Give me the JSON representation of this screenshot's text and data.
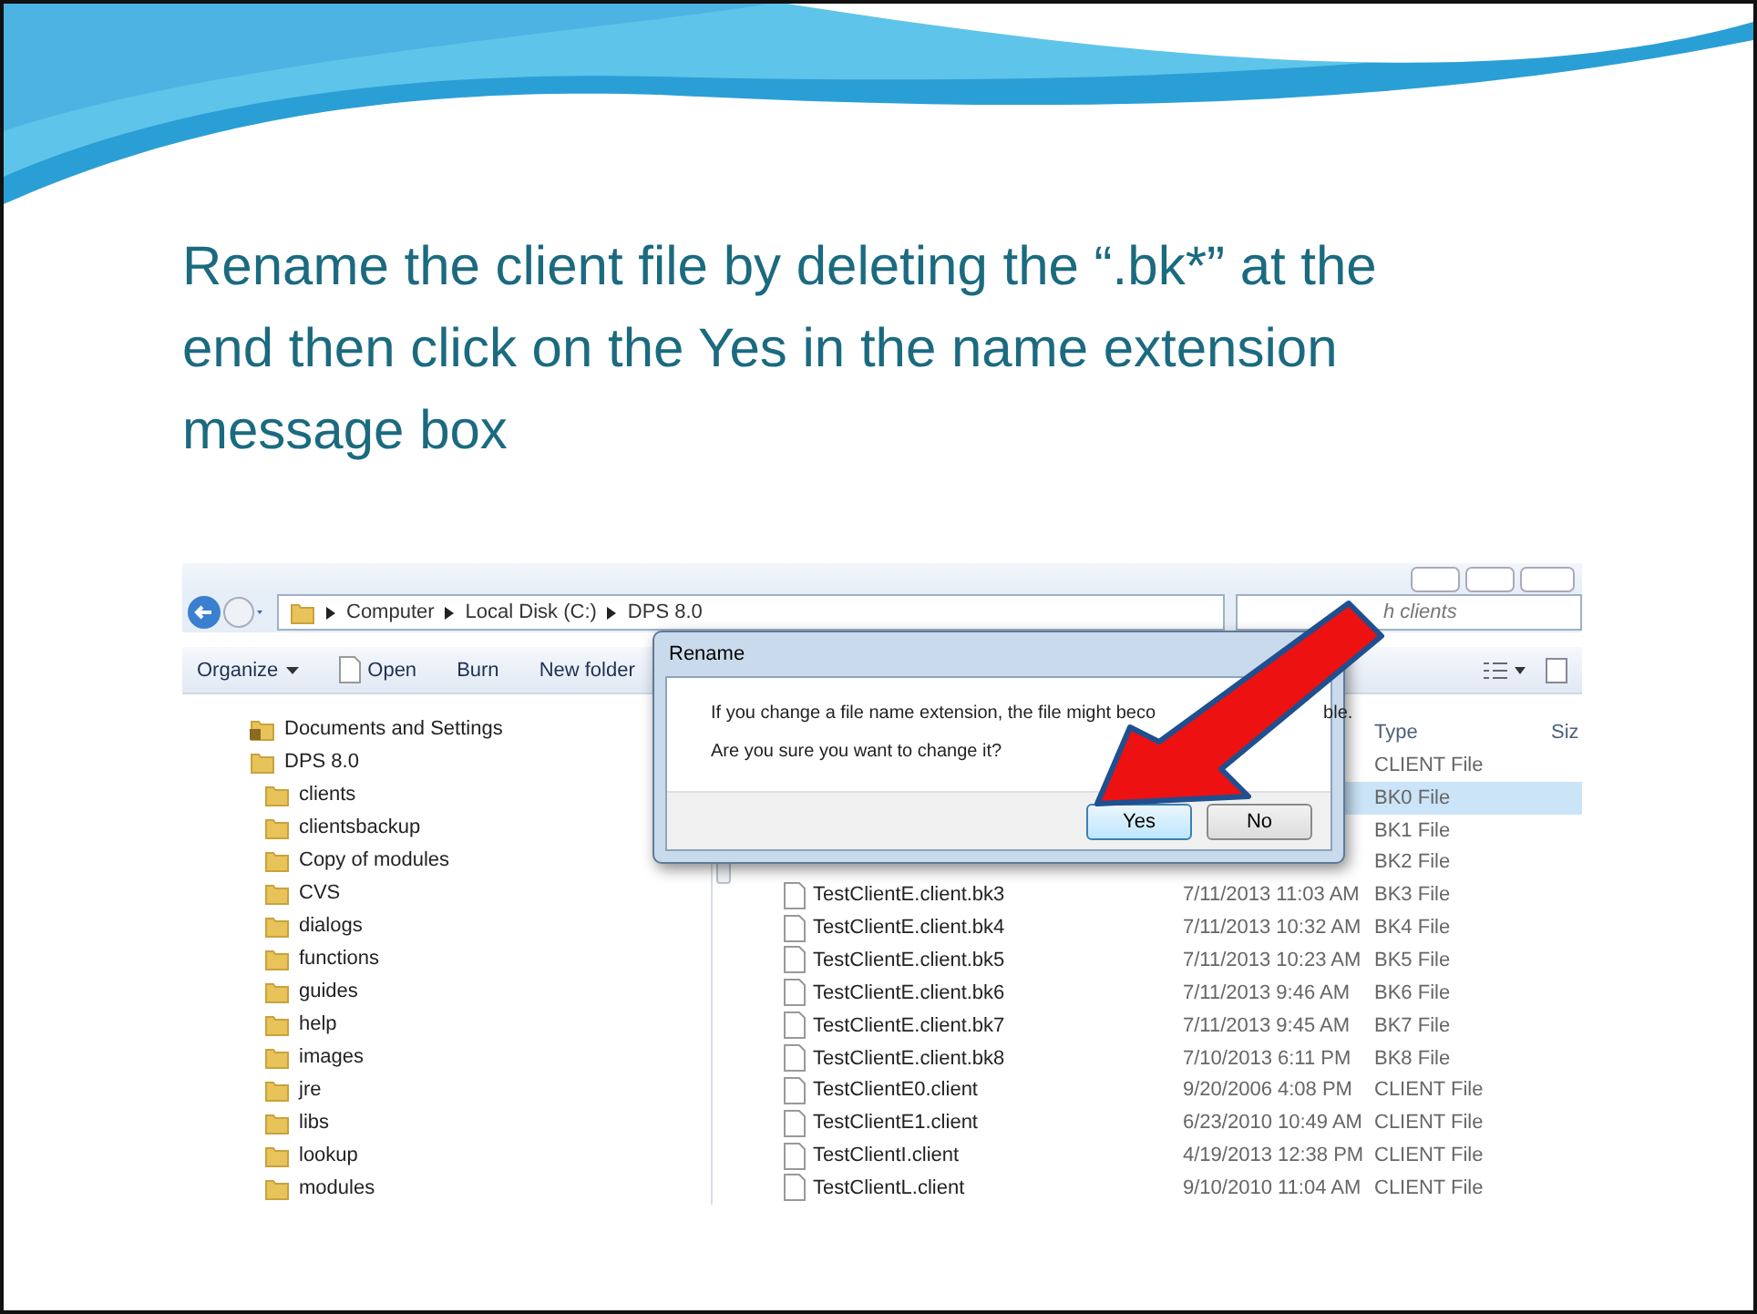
{
  "slide": {
    "title": "Rename the client file by deleting the “.bk*” at the end then click on the Yes in the name extension message box"
  },
  "explorer": {
    "address_path": [
      "Computer",
      "Local Disk (C:)",
      "DPS 8.0"
    ],
    "search_text": "h clients",
    "toolbar": [
      {
        "label": "Organize",
        "kind": "menu"
      },
      {
        "label": "Open",
        "kind": "file"
      },
      {
        "label": "Burn",
        "kind": "plain"
      },
      {
        "label": "New folder",
        "kind": "plain"
      }
    ],
    "tree": [
      {
        "label": "Documents and Settings",
        "locked": true
      },
      {
        "label": "DPS 8.0",
        "locked": false,
        "children": [
          {
            "label": "clients",
            "locked": false
          },
          {
            "label": "clientsbackup",
            "locked": false
          },
          {
            "label": "Copy of modules",
            "locked": false
          },
          {
            "label": "CVS",
            "locked": false
          },
          {
            "label": "dialogs",
            "locked": false
          },
          {
            "label": "functions",
            "locked": false
          },
          {
            "label": "guides",
            "locked": false
          },
          {
            "label": "help",
            "locked": false
          },
          {
            "label": "images",
            "locked": false
          },
          {
            "label": "jre",
            "locked": false
          },
          {
            "label": "libs",
            "locked": false
          },
          {
            "label": "lookup",
            "locked": false
          },
          {
            "label": "modules",
            "locked": false
          }
        ]
      }
    ],
    "columns": [
      "Type",
      "Siz"
    ],
    "files": [
      {
        "type": "CLIENT File",
        "selected": false
      },
      {
        "type": "BK0 File",
        "selected": true
      },
      {
        "type": "BK1 File",
        "selected": false
      },
      {
        "type": "BK2 File",
        "selected": false
      },
      {
        "name": "TestClientE.client.bk3",
        "date": "7/11/2013 11:03 AM",
        "type": "BK3 File",
        "selected": false
      },
      {
        "name": "TestClientE.client.bk4",
        "date": "7/11/2013 10:32 AM",
        "type": "BK4 File",
        "selected": false
      },
      {
        "name": "TestClientE.client.bk5",
        "date": "7/11/2013 10:23 AM",
        "type": "BK5 File",
        "selected": false
      },
      {
        "name": "TestClientE.client.bk6",
        "date": "7/11/2013 9:46 AM",
        "type": "BK6 File",
        "selected": false
      },
      {
        "name": "TestClientE.client.bk7",
        "date": "7/11/2013 9:45 AM",
        "type": "BK7 File",
        "selected": false
      },
      {
        "name": "TestClientE.client.bk8",
        "date": "7/10/2013 6:11 PM",
        "type": "BK8 File",
        "selected": false
      },
      {
        "name": "TestClientE0.client",
        "date": "9/20/2006 4:08 PM",
        "type": "CLIENT File",
        "selected": false
      },
      {
        "name": "TestClientE1.client",
        "date": "6/23/2010 10:49 AM",
        "type": "CLIENT File",
        "selected": false
      },
      {
        "name": "TestClientI.client",
        "date": "4/19/2013 12:38 PM",
        "type": "CLIENT File",
        "selected": false
      },
      {
        "name": "TestClientL.client",
        "date": "9/10/2010 11:04 AM",
        "type": "CLIENT File",
        "selected": false
      }
    ],
    "dialog": {
      "title": "Rename",
      "message_start": "If you change a file name extension, the file might beco",
      "message_end": "ble.",
      "question": "Are you sure you want to change it?",
      "buttons": [
        {
          "label": "Yes",
          "selected": true
        },
        {
          "label": "No",
          "selected": false
        }
      ]
    }
  }
}
